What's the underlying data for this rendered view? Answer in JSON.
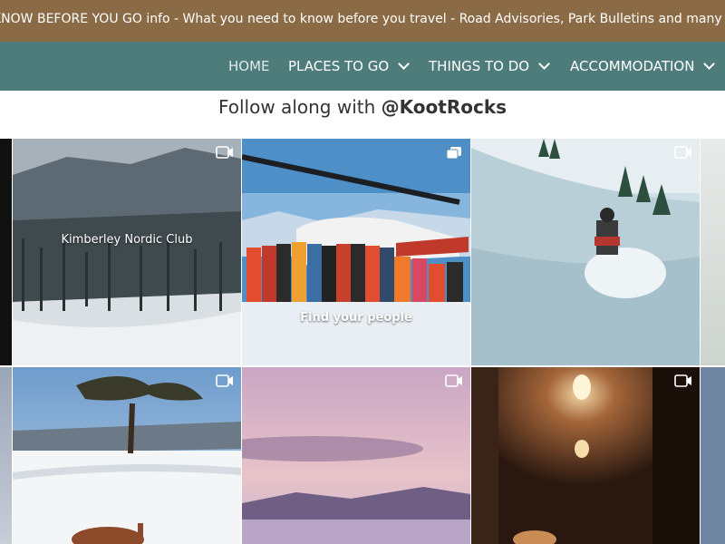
{
  "ticker": {
    "text": "KNOW BEFORE YOU GO info - What you need to know before you travel - Road Advisories, Park Bulletins and many information"
  },
  "nav": {
    "home": "HOME",
    "places": "PLACES TO GO",
    "things": "THINGS TO DO",
    "accommodation": "ACCOMMODATION"
  },
  "feed": {
    "prefix": "Follow along with ",
    "handle": "@KootRocks"
  },
  "posts": [
    {
      "caption": "Kimberley Nordic Club",
      "icon": "video-icon"
    },
    {
      "caption": "Find your people",
      "icon": "carousel-icon"
    },
    {
      "caption": "",
      "icon": "video-icon"
    },
    {
      "caption": "",
      "icon": "video-icon"
    },
    {
      "caption": "",
      "icon": "video-icon"
    },
    {
      "caption": "",
      "icon": "video-icon"
    }
  ],
  "colors": {
    "ticker_bg": "#8b6b45",
    "nav_bg": "#4e7c7b"
  }
}
